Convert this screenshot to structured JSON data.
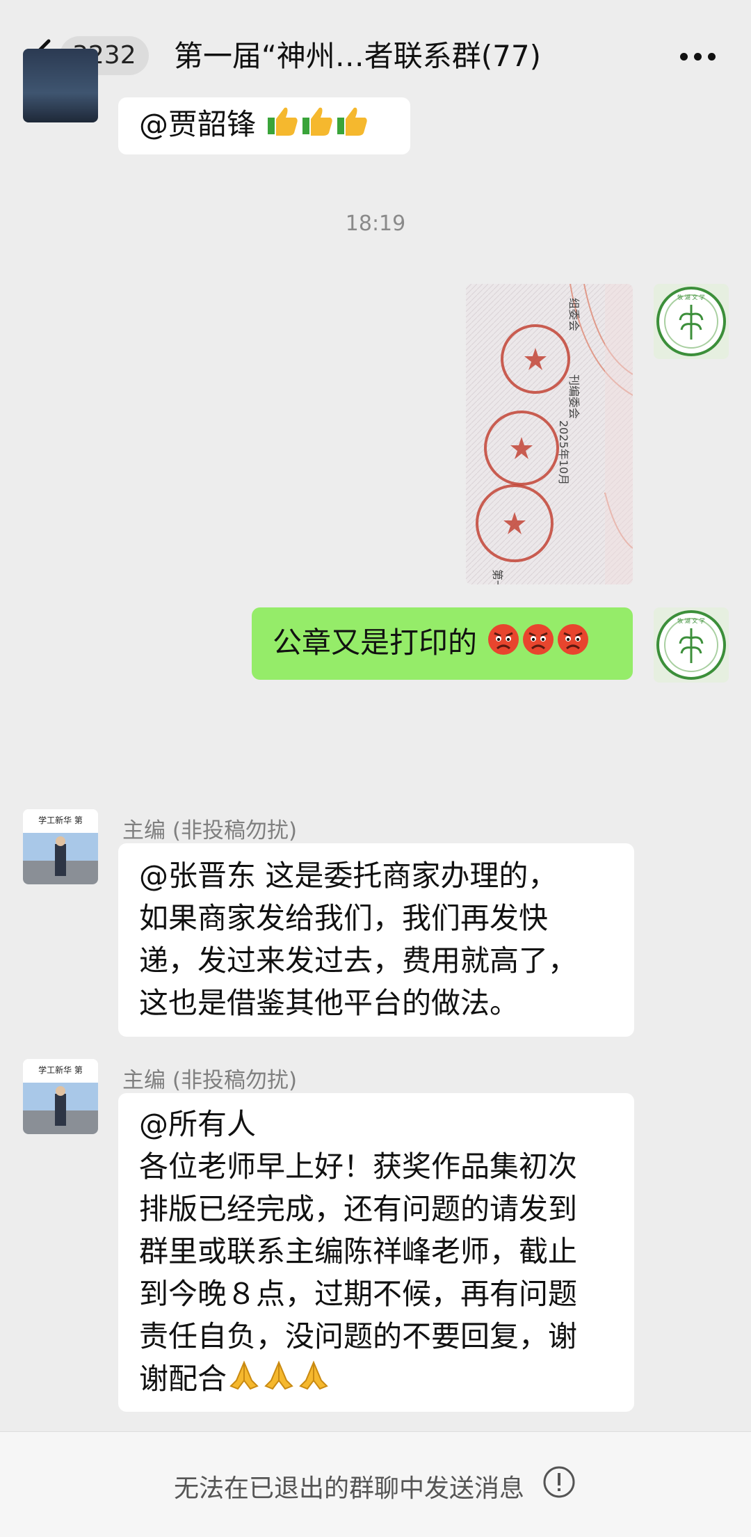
{
  "header": {
    "back_icon": "chevron-left-icon",
    "unread_count": "3232",
    "title": "第一届“神州…者联系群(77)",
    "more_icon": "ellipsis-icon"
  },
  "messages": [
    {
      "id": "m0",
      "side": "left",
      "type": "text",
      "text": "@贾韶锋 ",
      "emojis": [
        "thumbs-up",
        "thumbs-up",
        "thumbs-up"
      ]
    },
    {
      "id": "ts",
      "type": "timestamp",
      "text": "18:19"
    },
    {
      "id": "m1",
      "side": "right",
      "type": "image",
      "image_desc": "stamp-photo",
      "stamp_texts": [
        "第一届",
        "组委会",
        "刊编委会",
        "2025年10月"
      ]
    },
    {
      "id": "m2",
      "side": "right",
      "type": "text",
      "text": "公章又是打印的",
      "emojis": [
        "angry-face",
        "angry-face",
        "angry-face"
      ]
    },
    {
      "id": "m3",
      "side": "left",
      "type": "text",
      "sender": "主编 (非投稿勿扰)",
      "lines": [
        "@张晋东  这是委托商家办理的，",
        "如果商家发给我们，我们再发快",
        "递，发过来发过去，费用就高了，",
        "这也是借鉴其他平台的做法。"
      ]
    },
    {
      "id": "m4",
      "side": "left",
      "type": "text",
      "sender": "主编 (非投稿勿扰)",
      "lines": [
        "@所有人",
        "各位老师早上好！获奖作品集初次",
        "排版已经完成，还有问题的请发到",
        "群里或联系主编陈祥峰老师，截止",
        "到今晚８点，过期不候，再有问题",
        "责任自负，没问题的不要回复，谢",
        "谢配合"
      ],
      "emojis": [
        "folded-hands",
        "folded-hands",
        "folded-hands"
      ]
    }
  ],
  "bottom_bar": {
    "text": "无法在已退出的群聊中发送消息",
    "icon": "info-circle-icon"
  },
  "avatar_texts": {
    "self_logo": "牧 湖 文 学",
    "editor_banner": "学工新华 第"
  },
  "colors": {
    "background": "#ededed",
    "self_bubble": "#95ec69",
    "other_bubble": "#ffffff",
    "meta_text": "#7f7f7f"
  }
}
